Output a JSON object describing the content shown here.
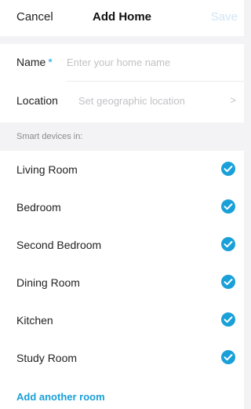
{
  "header": {
    "cancel_label": "Cancel",
    "title": "Add Home",
    "save_label": "Save"
  },
  "form": {
    "name_label": "Name",
    "required_marker": "*",
    "name_placeholder": "Enter your home name",
    "location_label": "Location",
    "location_placeholder": "Set geographic location",
    "location_chevron": ">"
  },
  "rooms_section": {
    "header": "Smart devices in:",
    "rooms": [
      {
        "label": "Living Room",
        "checked": true
      },
      {
        "label": "Bedroom",
        "checked": true
      },
      {
        "label": "Second Bedroom",
        "checked": true
      },
      {
        "label": "Dining Room",
        "checked": true
      },
      {
        "label": "Kitchen",
        "checked": true
      },
      {
        "label": "Study Room",
        "checked": true
      }
    ],
    "add_room_label": "Add another room"
  },
  "colors": {
    "accent": "#1aa0d8",
    "save_disabled": "#cfe7f6",
    "background": "#f3f3f5"
  }
}
